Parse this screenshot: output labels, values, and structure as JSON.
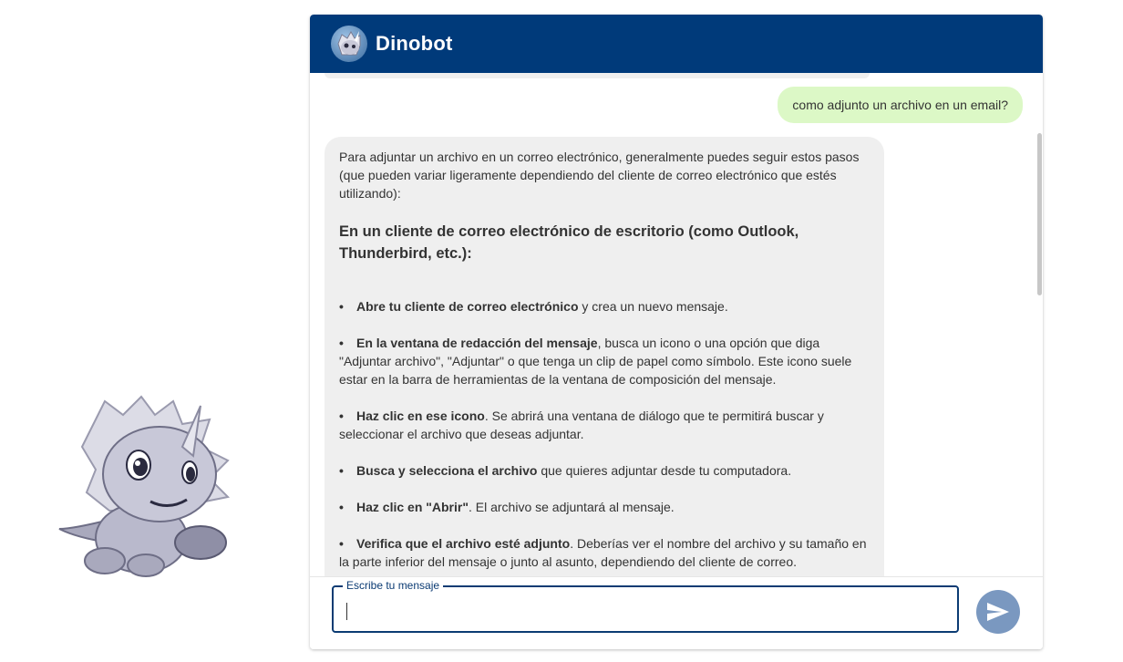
{
  "header": {
    "title": "Dinobot",
    "avatar_icon": "dino-avatar-icon"
  },
  "messages": {
    "user": {
      "text": "como adjunto un archivo en un email?"
    },
    "bot": {
      "intro": "Para adjuntar un archivo en un correo electrónico, generalmente puedes seguir estos pasos (que pueden variar ligeramente dependiendo del cliente de correo electrónico que estés utilizando):",
      "heading": "En un cliente de correo electrónico de escritorio (como Outlook, Thunderbird, etc.):",
      "steps": [
        {
          "bold": "Abre tu cliente de correo electrónico",
          "rest": " y crea un nuevo mensaje."
        },
        {
          "bold": "En la ventana de redacción del mensaje",
          "rest": ", busca un icono o una opción que diga \"Adjuntar archivo\", \"Adjuntar\" o que tenga un clip de papel como símbolo. Este icono suele estar en la barra de herramientas de la ventana de composición del mensaje."
        },
        {
          "bold": "Haz clic en ese icono",
          "rest": ". Se abrirá una ventana de diálogo que te permitirá buscar y seleccionar el archivo que deseas adjuntar."
        },
        {
          "bold": "Busca y selecciona el archivo",
          "rest": " que quieres adjuntar desde tu computadora."
        },
        {
          "bold": "Haz clic en \"Abrir\"",
          "rest": ". El archivo se adjuntará al mensaje."
        },
        {
          "bold": "Verifica que el archivo esté adjunto",
          "rest": ". Deberías ver el nombre del archivo y su tamaño en la parte inferior del mensaje o junto al asunto, dependiendo del cliente de correo."
        }
      ]
    }
  },
  "input": {
    "label": "Escribe tu mensaje",
    "value": "",
    "send_icon": "send-icon"
  },
  "colors": {
    "header_bg": "#003a7a",
    "user_bubble": "#dcf8c6",
    "bot_bubble": "#efefef",
    "send_button": "#7a98c0",
    "field_border": "#0b3b73"
  }
}
